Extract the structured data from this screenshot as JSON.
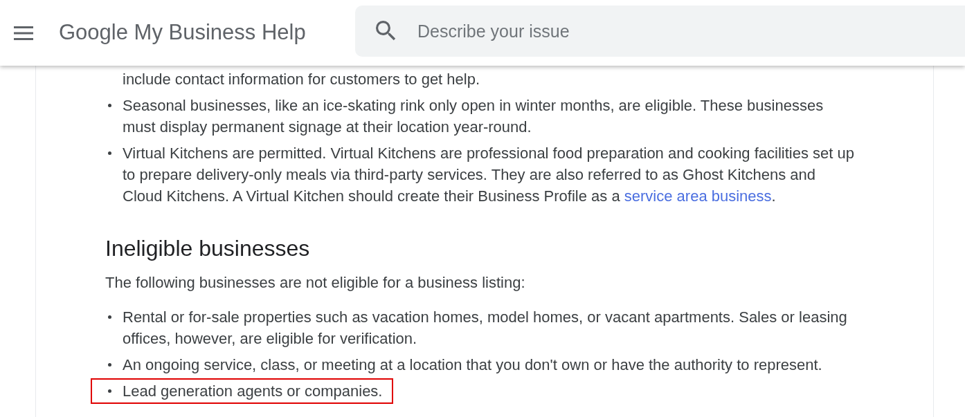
{
  "header": {
    "title": "Google My Business Help",
    "search": {
      "placeholder": "Describe your issue"
    }
  },
  "eligible_items": [
    {
      "kind": "continuation",
      "text": "include contact information for customers to get help."
    },
    {
      "kind": "bullet",
      "text": "Seasonal businesses, like an ice-skating rink only open in winter months, are eligible. These businesses must display permanent signage at their location year-round."
    },
    {
      "kind": "bullet",
      "text": "Virtual Kitchens are permitted. Virtual Kitchens are professional food preparation and cooking facilities set up to prepare delivery-only meals via third-party services. They are also referred to as Ghost Kitchens and Cloud Kitchens. A Virtual Kitchen should create their Business Profile as a ",
      "link": "service area business",
      "text_after": "."
    }
  ],
  "ineligible": {
    "heading": "Ineligible businesses",
    "intro": "The following businesses are not eligible for a business listing:",
    "items": [
      {
        "text": "Rental or for-sale properties such as vacation homes, model homes, or vacant apartments. Sales or leasing offices, however, are eligible for verification.",
        "highlighted": false
      },
      {
        "text": "An ongoing service, class, or meeting at a location that you don't own or have the authority to represent.",
        "highlighted": false
      },
      {
        "text": "Lead generation agents or companies.",
        "highlighted": true
      }
    ]
  }
}
